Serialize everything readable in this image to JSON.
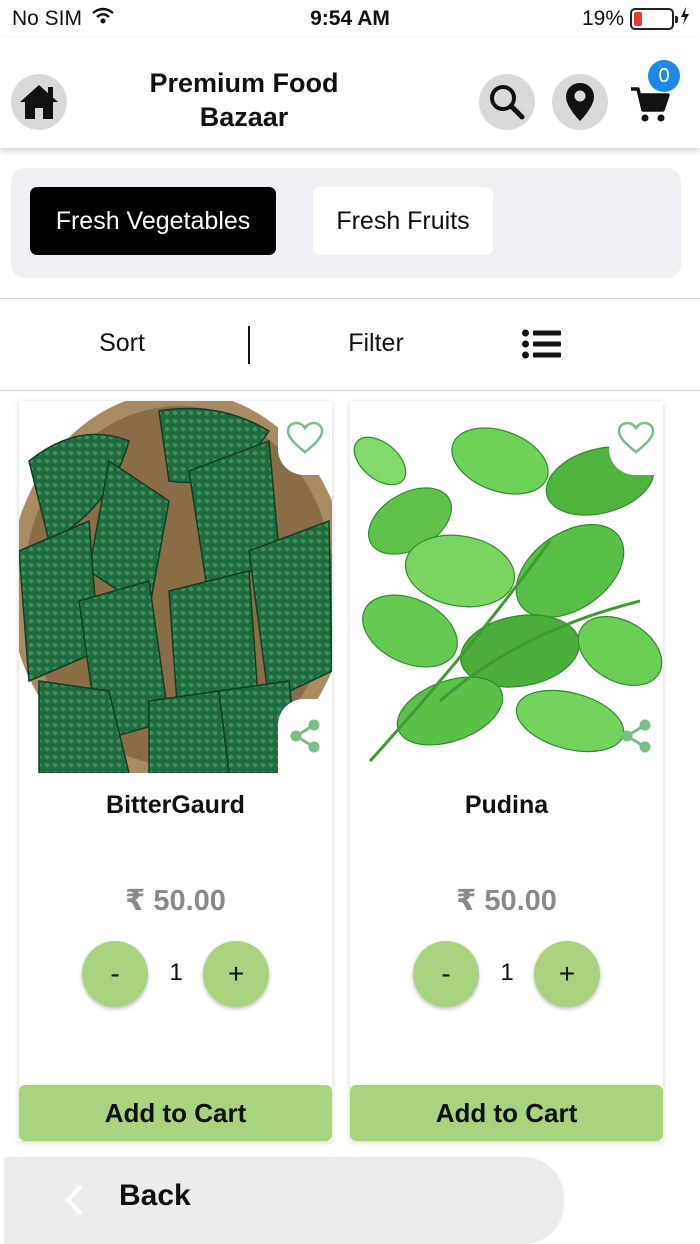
{
  "status_bar": {
    "carrier": "No SIM",
    "time": "9:54 AM",
    "battery": "19%",
    "battery_level": 0.19
  },
  "header": {
    "title_line1": "Premium Food",
    "title_line2": "Bazaar",
    "cart_count": "0"
  },
  "categories": [
    {
      "label": "Fresh Vegetables",
      "active": true
    },
    {
      "label": "Fresh Fruits",
      "active": false
    }
  ],
  "toolbar": {
    "sort": "Sort",
    "filter": "Filter"
  },
  "products": [
    {
      "name": "BitterGaurd",
      "price": "₹ 50.00",
      "qty": "1",
      "minus": "-",
      "plus": "+",
      "add_to_cart": "Add to Cart"
    },
    {
      "name": "Pudina",
      "price": "₹ 50.00",
      "qty": "1",
      "minus": "-",
      "plus": "+",
      "add_to_cart": "Add to Cart"
    }
  ],
  "footer": {
    "back": "Back"
  },
  "colors": {
    "accent_green": "#a9d37f",
    "badge_blue": "#1e88e5",
    "share_green": "#7bbf88"
  }
}
